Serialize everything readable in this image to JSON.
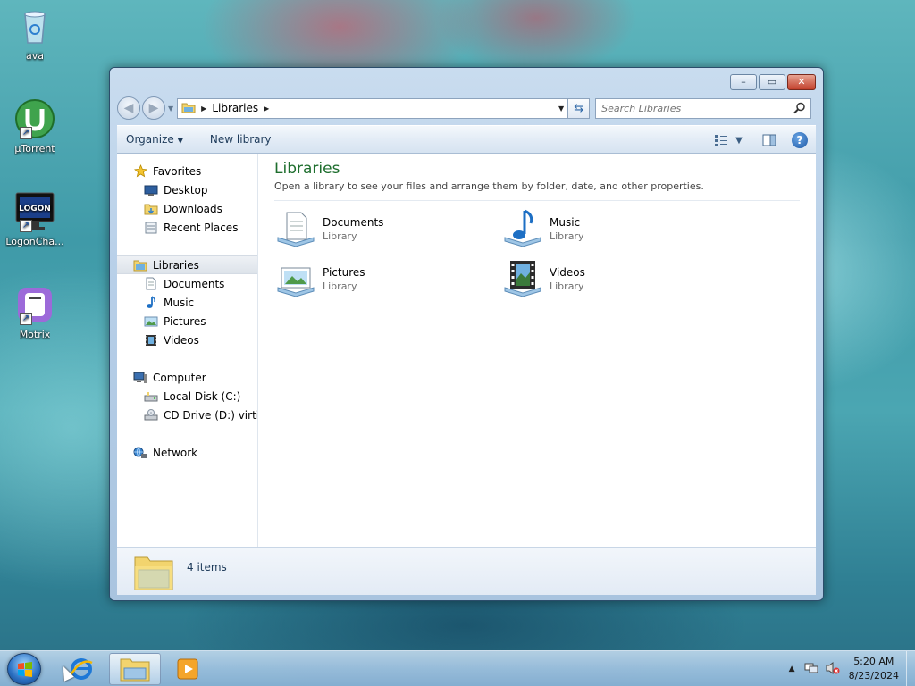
{
  "desktop": {
    "icons": [
      {
        "label": "ava",
        "icon": "recycle-bin-icon"
      },
      {
        "label": "µTorrent",
        "icon": "utorrent-icon"
      },
      {
        "label": "LogonCha...",
        "icon": "logon-changer-icon"
      },
      {
        "label": "Motrix",
        "icon": "motrix-icon"
      }
    ],
    "logon_badge": "LOGON",
    "shortcut_glyph": "↗"
  },
  "window": {
    "caption": {
      "minimize": "–",
      "maximize": "▭",
      "close": "✕"
    },
    "address": {
      "crumb": "Libraries"
    },
    "search": {
      "placeholder": "Search Libraries"
    },
    "toolbar": {
      "organize": "Organize",
      "new_library": "New library"
    },
    "nav": {
      "favorites": "Favorites",
      "favorites_items": [
        "Desktop",
        "Downloads",
        "Recent Places"
      ],
      "libraries": "Libraries",
      "libraries_items": [
        "Documents",
        "Music",
        "Pictures",
        "Videos"
      ],
      "computer": "Computer",
      "computer_items": [
        "Local Disk (C:)",
        "CD Drive (D:) virtio-w"
      ],
      "network": "Network"
    },
    "main": {
      "title": "Libraries",
      "description": "Open a library to see your files and arrange them by folder, date, and other properties.",
      "items": [
        {
          "name": "Documents",
          "kind": "Library"
        },
        {
          "name": "Music",
          "kind": "Library"
        },
        {
          "name": "Pictures",
          "kind": "Library"
        },
        {
          "name": "Videos",
          "kind": "Library"
        }
      ]
    },
    "details": {
      "count": "4 items"
    }
  },
  "taskbar": {
    "time": "5:20 AM",
    "date": "8/23/2024",
    "tray_arrow": "▲"
  },
  "colors": {
    "title_green": "#1e6e2e",
    "selection": "#dde3ea",
    "window_frame": "#b7cfe8"
  }
}
